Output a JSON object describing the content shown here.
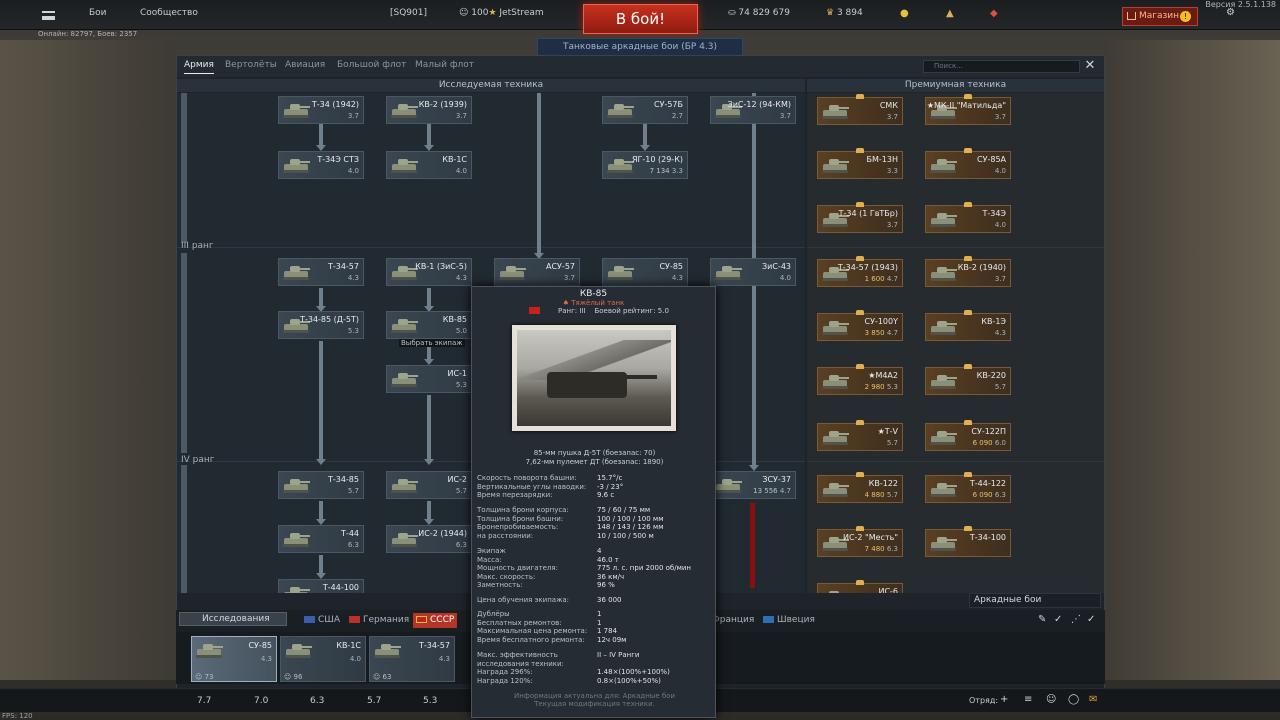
{
  "topbar": {
    "menu_icon": "hamburger-icon",
    "battles": "Бои",
    "community": "Сообщество",
    "squadron": "[SQ901]",
    "level": "100",
    "nickname": "JetStream",
    "battle_button": "В бой!",
    "silver": "74 829 679",
    "gold": "3 894",
    "shop": "Магазин",
    "version": "Версия 2.5.1.138",
    "online": "Онлайн: 82797, Боев: 2357",
    "mode_label": "Танковые аркадные бои (БР 4.3)"
  },
  "tabs": [
    "Армия",
    "Вертолёты",
    "Авиация",
    "Большой флот",
    "Малый флот"
  ],
  "search_placeholder": "Поиск...",
  "headers": {
    "research": "Исследуемая техника",
    "premium": "Премиумная техника"
  },
  "ranks": [
    "III ранг",
    "IV ранг"
  ],
  "tree": [
    {
      "name": "Т-34 (1942)",
      "br": "3.7"
    },
    {
      "name": "КВ-2 (1939)",
      "br": "3.7"
    },
    {
      "name": "СУ-57Б",
      "br": "2.7"
    },
    {
      "name": "ЗиС-12 (94-КМ)",
      "br": "3.7"
    },
    {
      "name": "Т-34Э СТЗ",
      "br": "4.0"
    },
    {
      "name": "КВ-1С",
      "br": "4.0"
    },
    {
      "name": "ЯГ-10 (29-К)",
      "br": "3.3",
      "cost": "7 134"
    },
    {
      "name": "Т-34-57",
      "br": "4.3"
    },
    {
      "name": "КВ-1 (ЗиС-5)",
      "br": "4.3"
    },
    {
      "name": "АСУ-57",
      "br": "3.7"
    },
    {
      "name": "СУ-85",
      "br": "4.3"
    },
    {
      "name": "ЗиС-43",
      "br": "4.0"
    },
    {
      "name": "Т-34-85 (Д-5Т)",
      "br": "5.3"
    },
    {
      "name": "КВ-85",
      "br": "5.0"
    },
    {
      "name": "ИС-1",
      "br": "5.3"
    },
    {
      "name": "Т-34-85",
      "br": "5.7"
    },
    {
      "name": "ИС-2",
      "br": "5.7"
    },
    {
      "name": "ЗСУ-37",
      "br": "4.7",
      "cost": "13 556"
    },
    {
      "name": "Т-44",
      "br": "6.3"
    },
    {
      "name": "ИС-2 (1944)",
      "br": "6.3"
    },
    {
      "name": "Т-44-100",
      "br": ""
    }
  ],
  "hover_label": "Выбрать экипаж",
  "premium": [
    {
      "name": "СМК",
      "br": "3.7"
    },
    {
      "name": "★МК-II \"Матильда\"",
      "br": "3.7"
    },
    {
      "name": "БМ-13Н",
      "br": "3.3"
    },
    {
      "name": "СУ-85А",
      "br": "4.0"
    },
    {
      "name": "Т-34 (1 ГвТБр)",
      "br": "3.7"
    },
    {
      "name": "Т-34Э",
      "br": "4.0"
    },
    {
      "name": "Т-34-57 (1943)",
      "br": "4.7",
      "cost": "1 600"
    },
    {
      "name": "КВ-2 (1940)",
      "br": "3.7"
    },
    {
      "name": "СУ-100Y",
      "br": "4.7",
      "cost": "3 850"
    },
    {
      "name": "КВ-1Э",
      "br": "4.3"
    },
    {
      "name": "★М4А2",
      "br": "5.3",
      "cost": "2 980"
    },
    {
      "name": "КВ-220",
      "br": "5.7"
    },
    {
      "name": "★Т-V",
      "br": "5.7"
    },
    {
      "name": "СУ-122П",
      "br": "6.0",
      "cost": "6 090"
    },
    {
      "name": "КВ-122",
      "br": "5.7",
      "cost": "4 880"
    },
    {
      "name": "Т-44-122",
      "br": "6.3",
      "cost": "6 090"
    },
    {
      "name": "ИС-2 \"Месть\"",
      "br": "6.3",
      "cost": "7 480"
    },
    {
      "name": "Т-34-100",
      "br": ""
    },
    {
      "name": "ИС-6",
      "br": ""
    }
  ],
  "tooltip": {
    "title": "КВ-85",
    "class": "Тяжёлый танк",
    "rank": "Ранг: III",
    "rating": "Боевой рейтинг: 5.0",
    "weapons": [
      "85-мм пушка Д-5Т (боезапас: 70)",
      "7,62-мм пулемет ДТ (боезапас: 1890)"
    ],
    "specs1": [
      [
        "Скорость поворота башни:",
        "15.7°/с"
      ],
      [
        "Вертикальные углы наводки:",
        "-3 / 23°"
      ],
      [
        "Время перезарядки:",
        "9.6 с"
      ]
    ],
    "specs2": [
      [
        "Толщина брони корпуса:",
        "75 / 60 / 75 мм"
      ],
      [
        "Толщина брони башни:",
        "100 / 100 / 100 мм"
      ],
      [
        "Бронепробиваемость:",
        "148 / 143 / 126 мм"
      ],
      [
        "на расстоянии:",
        "10 / 100 / 500 м"
      ]
    ],
    "specs3": [
      [
        "Экипаж",
        "4"
      ],
      [
        "Масса:",
        "46.0 т"
      ],
      [
        "Мощность двигателя:",
        "775 л. с. при 2000 об/мин"
      ],
      [
        "Макс. скорость:",
        "36 км/ч"
      ],
      [
        "Заметность:",
        "96 %"
      ]
    ],
    "crew_cost": [
      "Цена обучения экипажа:",
      "36 000"
    ],
    "specs4": [
      [
        "Дублёры",
        "1"
      ],
      [
        "Бесплатных ремонтов:",
        "1"
      ],
      [
        "Максимальная цена ремонта:",
        "1 784"
      ],
      [
        "Время бесплатного ремонта:",
        "12ч 09м"
      ]
    ],
    "specs5": [
      [
        "Макс. эффективность исследования техники:",
        "II – IV Ранги"
      ],
      [
        "Награда 296%:",
        "1.48×(100%+100%)"
      ],
      [
        "Награда 120%:",
        "0.8×(100%+50%)"
      ]
    ],
    "footer1": "Информация актуальна для: Аркадные бои",
    "footer2": "Текущая модификация техники."
  },
  "game_mode": "Аркадные бои",
  "research_button": "Исследования",
  "nations": [
    {
      "name": "США",
      "color": "#3b5ea8"
    },
    {
      "name": "Германия",
      "color": "#b8322a"
    },
    {
      "name": "СССР",
      "color": "#c8201a"
    },
    {
      "name": "Франция",
      "color": "#2c4aa0"
    },
    {
      "name": "Швеция",
      "color": "#2e6eb5"
    }
  ],
  "crew_slots": [
    {
      "name": "СУ-85",
      "br": "4.3",
      "count": "73"
    },
    {
      "name": "КВ-1С",
      "br": "4.0",
      "count": "96"
    },
    {
      "name": "Т-34-57",
      "br": "4.3",
      "count": "63"
    }
  ],
  "br_bar": [
    "7.7",
    "7.0",
    "6.3",
    "5.7",
    "5.3"
  ],
  "squad_label": "Отряд:",
  "fps": "FPS: 120",
  "colors": {
    "accent_red": "#c8301f",
    "premium_gold": "#e0b050",
    "active_nation": "#b53428"
  }
}
